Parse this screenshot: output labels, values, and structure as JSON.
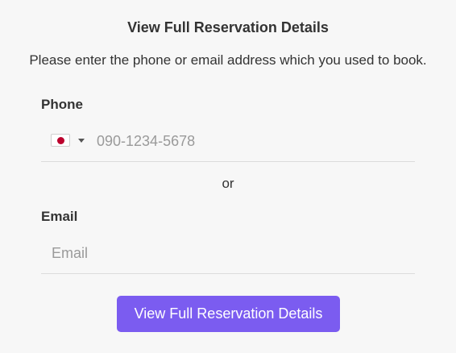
{
  "header": {
    "title": "View Full Reservation Details",
    "subtitle": "Please enter the phone or email address which you used to book."
  },
  "phone": {
    "label": "Phone",
    "country_flag": "japan-flag-icon",
    "placeholder": "090-1234-5678",
    "value": ""
  },
  "separator": {
    "text": "or"
  },
  "email": {
    "label": "Email",
    "placeholder": "Email",
    "value": ""
  },
  "submit": {
    "label": "View Full Reservation Details"
  },
  "colors": {
    "accent": "#7b5cf0",
    "background": "#f7f7f7",
    "flag_red": "#bc002d"
  }
}
